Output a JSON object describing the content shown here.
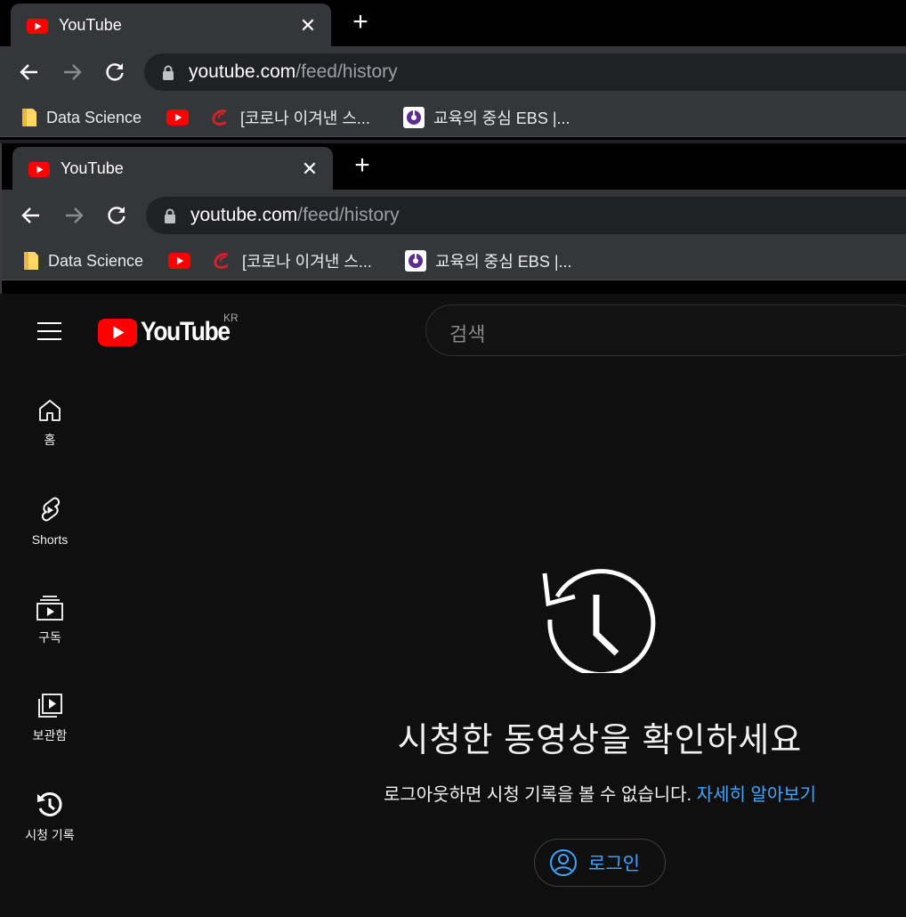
{
  "browser_outer": {
    "tab_title": "YouTube",
    "close_glyph": "✕",
    "newtab_glyph": "+",
    "url_host": "youtube.com",
    "url_path": "/feed/history",
    "bookmarks": [
      {
        "icon": "folder-icon",
        "label": "Data Science"
      },
      {
        "icon": "youtube-icon",
        "label": ""
      },
      {
        "icon": "red-swoosh-icon",
        "label": "[코로나 이겨낸 스..."
      },
      {
        "icon": "ebs-icon",
        "label": "교육의 중심 EBS |..."
      }
    ]
  },
  "browser_inner": {
    "tab_title": "YouTube",
    "close_glyph": "✕",
    "newtab_glyph": "+",
    "url_host": "youtube.com",
    "url_path": "/feed/history",
    "bookmarks": [
      {
        "icon": "folder-icon",
        "label": "Data Science"
      },
      {
        "icon": "youtube-icon",
        "label": ""
      },
      {
        "icon": "red-swoosh-icon",
        "label": "[코로나 이겨낸 스..."
      },
      {
        "icon": "ebs-icon",
        "label": "교육의 중심 EBS |..."
      }
    ]
  },
  "youtube": {
    "logo_text": "YouTube",
    "region": "KR",
    "search_placeholder": "검색",
    "sidebar": [
      {
        "icon": "home-icon",
        "label": "홈"
      },
      {
        "icon": "shorts-icon",
        "label": "Shorts"
      },
      {
        "icon": "subscriptions-icon",
        "label": "구독"
      },
      {
        "icon": "library-icon",
        "label": "보관함"
      },
      {
        "icon": "history-icon",
        "label": "시청 기록"
      }
    ],
    "empty_title": "시청한 동영상을 확인하세요",
    "empty_message": "로그아웃하면 시청 기록을 볼 수 없습니다.",
    "learn_more": "자세히 알아보기",
    "signin_label": "로그인"
  },
  "colors": {
    "accent_link": "#3ea6ff",
    "youtube_red": "#ff0000",
    "page_bg": "#0f0f0f",
    "chrome_toolbar": "#35363a"
  }
}
